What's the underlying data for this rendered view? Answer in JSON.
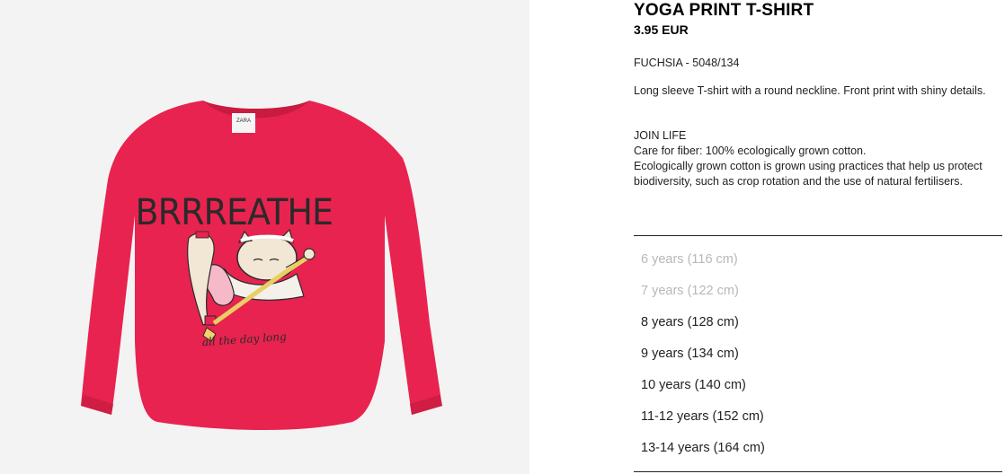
{
  "product": {
    "name": "YOGA PRINT T-SHIRT",
    "price": "3.95 EUR",
    "color_ref": "FUCHSIA - 5048/134",
    "description": "Long sleeve T-shirt with a round neckline. Front print with shiny details.",
    "join_life": {
      "heading": "JOIN LIFE",
      "lines": [
        "Care for fiber: 100% ecologically grown cotton.",
        "Ecologically grown cotton is grown using practices that help us protect biodiversity, such as crop rotation and the use of natural fertilisers."
      ]
    },
    "image": {
      "print_text": "BRRREATHE",
      "print_script": "all the day long",
      "label_text": "ZARA",
      "shirt_color": "#e8234f",
      "background_color": "#f3f3f3"
    }
  },
  "sizes": [
    {
      "label": "6 years (116 cm)",
      "available": false
    },
    {
      "label": "7 years (122 cm)",
      "available": false
    },
    {
      "label": "8 years (128 cm)",
      "available": true
    },
    {
      "label": "9 years (134 cm)",
      "available": true
    },
    {
      "label": "10 years (140 cm)",
      "available": true
    },
    {
      "label": "11-12 years (152 cm)",
      "available": true
    },
    {
      "label": "13-14 years (164 cm)",
      "available": true
    }
  ]
}
